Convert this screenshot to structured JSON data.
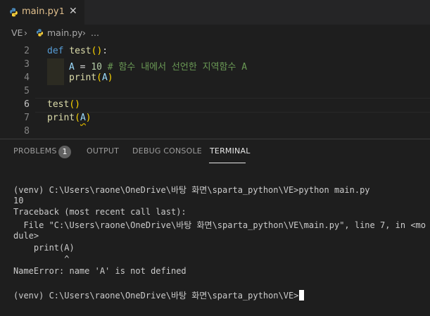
{
  "tab": {
    "filename": "main.py",
    "problems_count": "1",
    "close_glyph": "✕"
  },
  "breadcrumb": {
    "root": "VE",
    "file": "main.py",
    "more": "..."
  },
  "editor": {
    "lines": [
      {
        "num": "2",
        "text": "def test():"
      },
      {
        "num": "3",
        "text": "A = 10 # 함수 내에서 선언한 지역함수 A"
      },
      {
        "num": "4",
        "text": "print(A)"
      },
      {
        "num": "5",
        "text": ""
      },
      {
        "num": "6",
        "text": "test()"
      },
      {
        "num": "7",
        "text": "print(A)"
      },
      {
        "num": "8",
        "text": ""
      }
    ],
    "tokens": {
      "def": "def",
      "test": "test",
      "paren_open": "(",
      "paren_close": ")",
      "colon": ":",
      "A": "A",
      "eq": "=",
      "ten": "10",
      "comment": "# 함수 내에서 선언한 지역함수 A",
      "print": "print"
    }
  },
  "panel": {
    "tabs": {
      "problems": "PROBLEMS",
      "output": "OUTPUT",
      "debug": "DEBUG CONSOLE",
      "terminal": "TERMINAL"
    },
    "badge": "1"
  },
  "terminal": {
    "lines": [
      "(venv) C:\\Users\\raone\\OneDrive\\바탕 화면\\sparta_python\\VE>python main.py",
      "10",
      "Traceback (most recent call last):",
      "  File \"C:\\Users\\raone\\OneDrive\\바탕 화면\\sparta_python\\VE\\main.py\", line 7, in <mo",
      "dule>",
      "    print(A)",
      "          ^",
      "NameError: name 'A' is not defined",
      "",
      "(venv) C:\\Users\\raone\\OneDrive\\바탕 화면\\sparta_python\\VE>"
    ]
  },
  "colors": {
    "accent_modified": "#e2c08d",
    "python_blue": "#4b8bbe",
    "python_yellow": "#ffd43b"
  }
}
